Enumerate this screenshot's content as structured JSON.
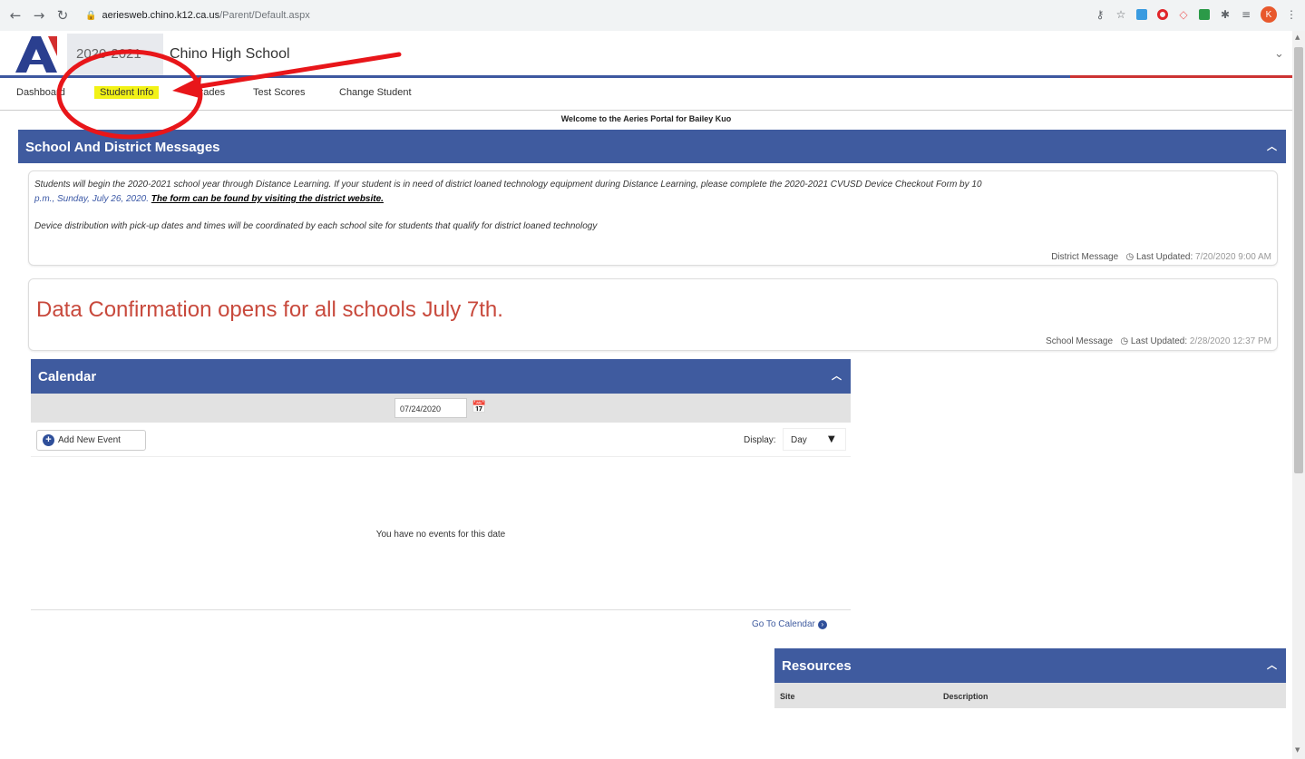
{
  "browser": {
    "url_host": "aeriesweb.chino.k12.ca.us",
    "url_path": "/Parent/Default.aspx",
    "profile_initial": "K"
  },
  "header": {
    "school_year": "2020-2021",
    "school_name": "Chino High School"
  },
  "tabs": [
    {
      "label": "Dashboard"
    },
    {
      "label": "Student Info"
    },
    {
      "label": "Grades"
    },
    {
      "label": "Test Scores"
    },
    {
      "label": "Change Student"
    }
  ],
  "welcome_text": "Welcome to the Aeries Portal for Bailey Kuo",
  "messages_panel": {
    "title": "School And District Messages",
    "district": {
      "text_part1": "Students will begin the 2020-2021 school year through Distance Learning. If your student is in need of district loaned technology equipment during Distance Learning, please complete the 2020-2021 CVUSD Device Checkout Form by 10",
      "text_part2": "p.m., Sunday, July 26, 2020.",
      "link_text": "The form can be found by visiting the district website.",
      "text_line2": "Device distribution with pick-up dates and times will be coordinated by each school site for students that qualify for district loaned technology",
      "source": "District Message",
      "updated_label": "Last Updated:",
      "updated_value": "7/20/2020 9:00 AM"
    },
    "school": {
      "text": "Data Confirmation opens for all schools July 7th.",
      "source": "School Message",
      "updated_label": "Last Updated:",
      "updated_value": "2/28/2020 12:37 PM"
    }
  },
  "calendar": {
    "title": "Calendar",
    "date": "07/24/2020",
    "add_event_label": "Add New Event",
    "display_label": "Display:",
    "display_value": "Day",
    "empty_text": "You have no events for this date",
    "go_to_label": "Go To Calendar"
  },
  "resources": {
    "title": "Resources",
    "columns": [
      "Site",
      "Description"
    ]
  },
  "colors": {
    "panel_header": "#3f5b9f",
    "active_tab_highlight": "#f2f216",
    "annotation_red": "#e8161a",
    "school_message": "#c8493c"
  }
}
